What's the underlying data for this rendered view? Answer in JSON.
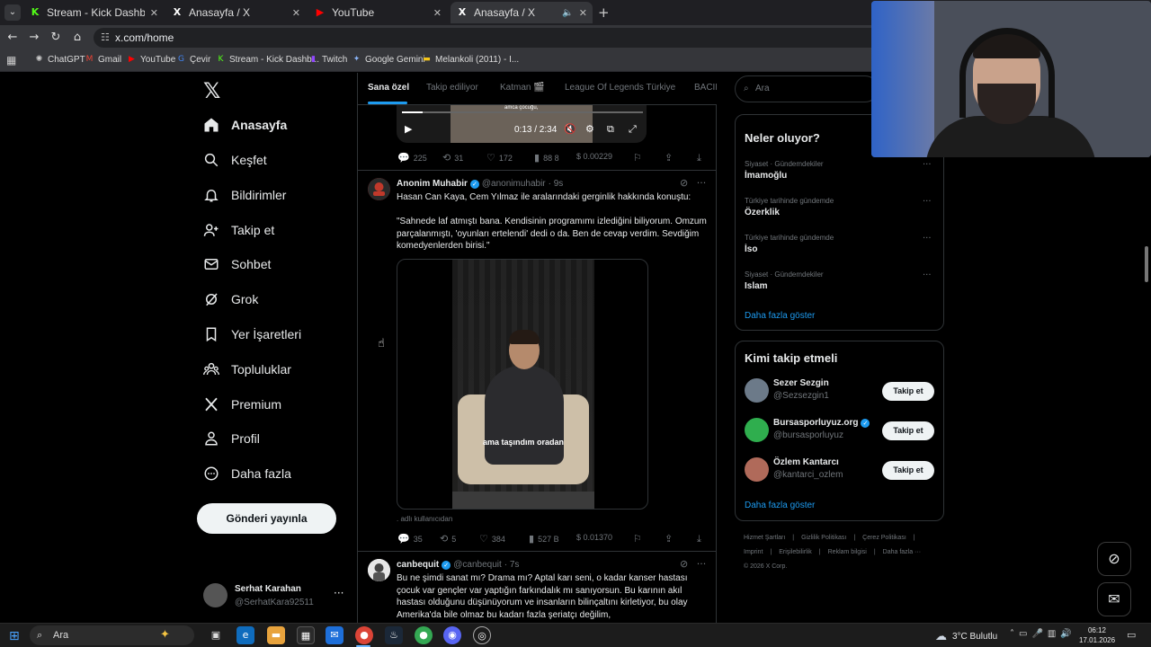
{
  "browser": {
    "tabs": [
      {
        "label": "Stream - Kick Dashboard",
        "icon": "K",
        "color": "#53fc18",
        "active": false
      },
      {
        "label": "Anasayfa / X",
        "icon": "X",
        "color": "#ffffff",
        "active": false
      },
      {
        "label": "YouTube",
        "icon": "▶",
        "color": "#ff0000",
        "active": false
      },
      {
        "label": "Anasayfa / X",
        "icon": "X",
        "color": "#ffffff",
        "active": true
      }
    ],
    "url": "x.com/home",
    "bookmarks": [
      {
        "label": "ChatGPT",
        "icon": "✺",
        "color": "#cccccc"
      },
      {
        "label": "Gmail",
        "icon": "M",
        "color": "#ea4335"
      },
      {
        "label": "YouTube",
        "icon": "▶",
        "color": "#ff0000"
      },
      {
        "label": "Çevir",
        "icon": "G",
        "color": "#4285f4"
      },
      {
        "label": "Stream - Kick Dashb...",
        "icon": "K",
        "color": "#53fc18"
      },
      {
        "label": "Twitch",
        "icon": "▮",
        "color": "#9146ff"
      },
      {
        "label": "Google Gemini",
        "icon": "✦",
        "color": "#8ab4f8"
      },
      {
        "label": "Melankoli (2011) - I...",
        "icon": "▬",
        "color": "#f5c518"
      }
    ]
  },
  "sidebar": {
    "items": [
      {
        "label": "Anasayfa",
        "icon": "home-icon"
      },
      {
        "label": "Keşfet",
        "icon": "search-icon"
      },
      {
        "label": "Bildirimler",
        "icon": "bell-icon"
      },
      {
        "label": "Takip et",
        "icon": "follow-icon"
      },
      {
        "label": "Sohbet",
        "icon": "mail-icon"
      },
      {
        "label": "Grok",
        "icon": "grok-icon"
      },
      {
        "label": "Yer İşaretleri",
        "icon": "bookmark-icon"
      },
      {
        "label": "Topluluklar",
        "icon": "people-icon"
      },
      {
        "label": "Premium",
        "icon": "x-icon"
      },
      {
        "label": "Profil",
        "icon": "person-icon"
      },
      {
        "label": "Daha fazla",
        "icon": "more-icon"
      }
    ],
    "post_button": "Gönderi yayınla",
    "account": {
      "name": "Serhat Karahan",
      "handle": "@SerhatKara92511"
    }
  },
  "feed": {
    "tabs": [
      "Sana özel",
      "Takip ediliyor",
      "Katman 🎬",
      "League Of Legends Türkiye",
      "BACIL"
    ],
    "video1": {
      "subtitle": "amca çocuğu,",
      "time": "0:13 / 2:34",
      "progress": 0.0844
    },
    "post1_actions": {
      "replies": "225",
      "reposts": "31",
      "likes": "172",
      "views": "88 8",
      "tips": "$ 0.00229"
    },
    "post2": {
      "name": "Anonim Muhabir",
      "handle": "@anonimuhabir",
      "time": "· 9s",
      "text1": "Hasan Can Kaya, Cem Yılmaz ile aralarındaki gerginlik hakkında konuştu:",
      "text2": "\"Sahnede laf atmıştı bana. Kendisinin programımı izlediğini biliyorum. Omzum parçalanmıştı, 'oyunları ertelendi' dedi o da. Ben de cevap verdim. Sevdiğim komedyenlerden birisi.\"",
      "caption": "ama taşındım oradan",
      "media_footer": ". adlı kullanıcıdan",
      "actions": {
        "replies": "35",
        "reposts": "5",
        "likes": "384",
        "views": "527 B",
        "tips": "$ 0.01370"
      }
    },
    "post3": {
      "name": "canbequit",
      "handle": "@canbequit",
      "time": "· 7s",
      "text": "Bu ne şimdi sanat mı? Drama mı? Aptal karı seni, o kadar kanser hastası çocuk var gençler var yaptığın farkındalık mı sanıyorsun. Bu karının akıl hastası olduğunu düşünüyorum ve insanların bilinçaltını kirletiyor, bu olay Amerika'da bile olmaz bu kadarı fazla şeriatçı değilim,"
    }
  },
  "right": {
    "search_placeholder": "Ara",
    "trends_title": "Neler oluyor?",
    "trends": [
      {
        "category": "Siyaset · Gündemdekiler",
        "name": "İmamoğlu"
      },
      {
        "category": "Türkiye tarihinde gündemde",
        "name": "Özerklik"
      },
      {
        "category": "Türkiye tarihinde gündemde",
        "name": "İso"
      },
      {
        "category": "Siyaset · Gündemdekiler",
        "name": "Islam"
      }
    ],
    "trends_more": "Daha fazla göster",
    "follow_title": "Kimi takip etmeli",
    "who_to_follow": [
      {
        "name": "Sezer Sezgin",
        "handle": "@Sezsezgin1",
        "button": "Takip et",
        "color": "#6c7a89",
        "verified": false
      },
      {
        "name": "Bursasporluyuz.org",
        "handle": "@bursasporluyuz",
        "button": "Takip et",
        "color": "#2fae4e",
        "verified": true
      },
      {
        "name": "Özlem Kantarcı",
        "handle": "@kantarci_ozlem",
        "button": "Takip et",
        "color": "#b06a5a",
        "verified": false
      }
    ],
    "follow_more": "Daha fazla göster",
    "footer_links": [
      "Hizmet Şartları",
      "|",
      "Gizlilik Politikası",
      "|",
      "Çerez Politikası",
      "|",
      "Imprint",
      "|",
      "Erişilebilirlik",
      "|",
      "Reklam bilgisi",
      "|",
      "Daha fazla ···",
      "© 2026 X Corp."
    ]
  },
  "taskbar": {
    "search": "Ara",
    "weather": "3°C  Bulutlu",
    "time": "06:12",
    "date": "17.01.2026"
  }
}
